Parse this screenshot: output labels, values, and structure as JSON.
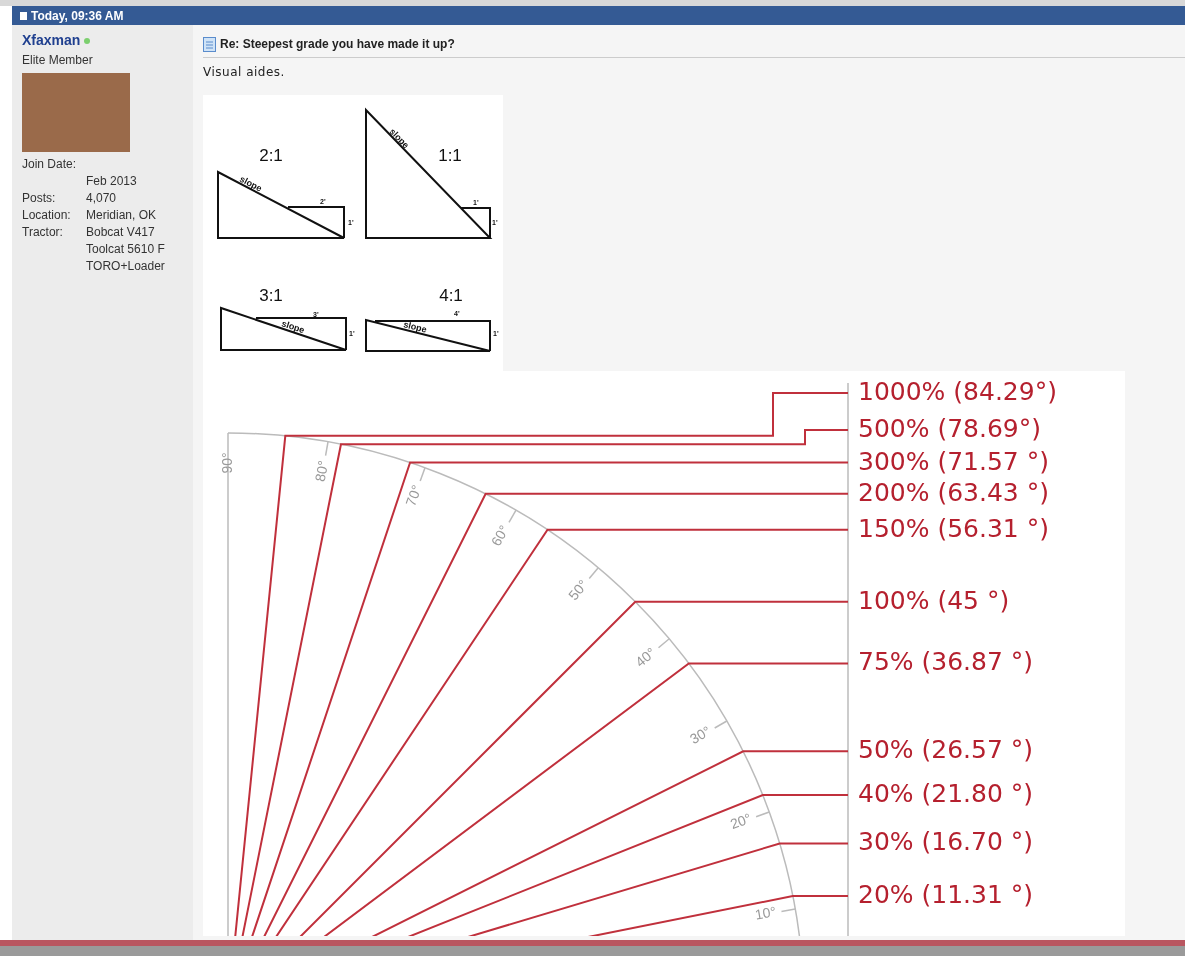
{
  "post_header": {
    "timestamp": "Today, 09:36 AM"
  },
  "user": {
    "name": "Xfaxman",
    "online": true,
    "rank": "Elite Member",
    "fields": [
      {
        "label": "Join Date:",
        "values": [
          "Feb 2013"
        ]
      },
      {
        "label": "Posts:",
        "values": [
          "4,070"
        ]
      },
      {
        "label": "Location:",
        "values": [
          "Meridian, OK"
        ]
      },
      {
        "label": "Tractor:",
        "values": [
          "Bobcat V417",
          "Toolcat 5610 F",
          "TORO+Loader"
        ]
      }
    ]
  },
  "post": {
    "title": "Re: Steepest grade you have made it up?",
    "text": "Visual aides.",
    "slope_diagrams": [
      {
        "ratio": "2:1",
        "run": "2'",
        "rise": "1'",
        "hyp": "slope"
      },
      {
        "ratio": "1:1",
        "run": "1'",
        "rise": "1'",
        "hyp": "slope"
      },
      {
        "ratio": "3:1",
        "run": "3'",
        "rise": "1'",
        "hyp": "slope"
      },
      {
        "ratio": "4:1",
        "run": "4'",
        "rise": "1'",
        "hyp": "slope"
      }
    ],
    "grade_chart": {
      "angle_ticks": [
        "90°",
        "80°",
        "70°",
        "60°",
        "50°",
        "40°",
        "30°",
        "20°",
        "10°"
      ],
      "grades": [
        "1000% (84.29°)",
        "500% (78.69°)",
        "300% (71.57 °)",
        "200% (63.43 °)",
        "150% (56.31 °)",
        "100% (45 °)",
        "75% (36.87 °)",
        "50% (26.57 °)",
        "40% (21.80 °)",
        "30% (16.70 °)",
        "20% (11.31 °)"
      ]
    }
  }
}
